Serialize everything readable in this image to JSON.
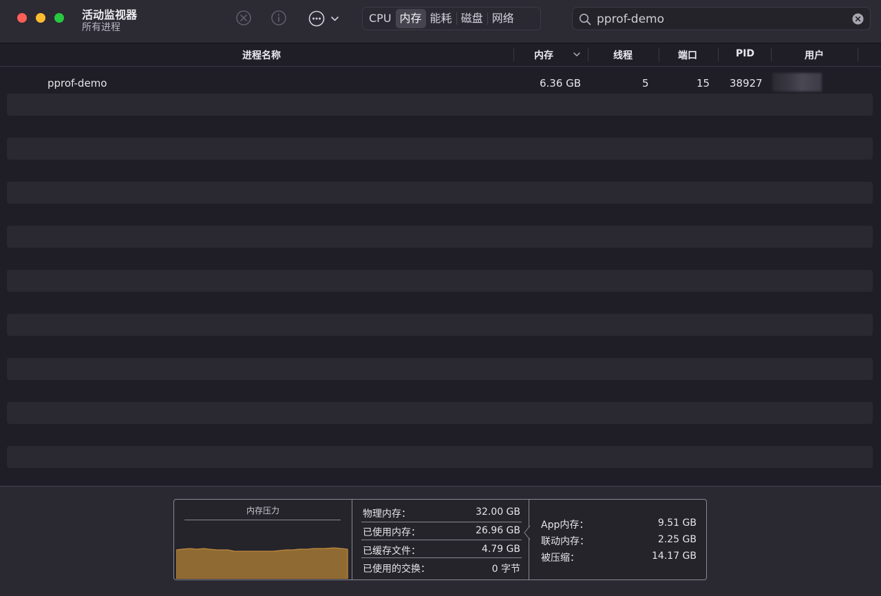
{
  "window": {
    "title": "活动监视器",
    "subtitle": "所有进程"
  },
  "toolbar": {
    "tabs": [
      "CPU",
      "内存",
      "能耗",
      "磁盘",
      "网络"
    ],
    "active_tab": "内存",
    "search_value": "pprof-demo"
  },
  "table": {
    "columns": {
      "name": "进程名称",
      "memory": "内存",
      "threads": "线程",
      "ports": "端口",
      "pid": "PID",
      "user": "用户"
    },
    "sorted_by": "内存",
    "rows": [
      {
        "name": "pprof-demo",
        "memory": "6.36 GB",
        "threads": "5",
        "ports": "15",
        "pid": "38927",
        "user": ""
      }
    ]
  },
  "memory_panel": {
    "graph_title": "内存压力",
    "pressure_color": "#a87a36",
    "physical_label": "物理内存：",
    "physical_value": "32.00 GB",
    "used_label": "已使用内存：",
    "used_value": "26.96 GB",
    "cached_label": "已缓存文件：",
    "cached_value": "4.79 GB",
    "swap_label": "已使用的交换：",
    "swap_value": "0 字节",
    "app_label": "App内存：",
    "app_value": "9.51 GB",
    "wired_label": "联动内存：",
    "wired_value": "2.25 GB",
    "compressed_label": "被压缩：",
    "compressed_value": "14.17 GB"
  },
  "colors": {
    "close": "#fe5f57",
    "minimize": "#febc2e",
    "zoom": "#28c840"
  }
}
